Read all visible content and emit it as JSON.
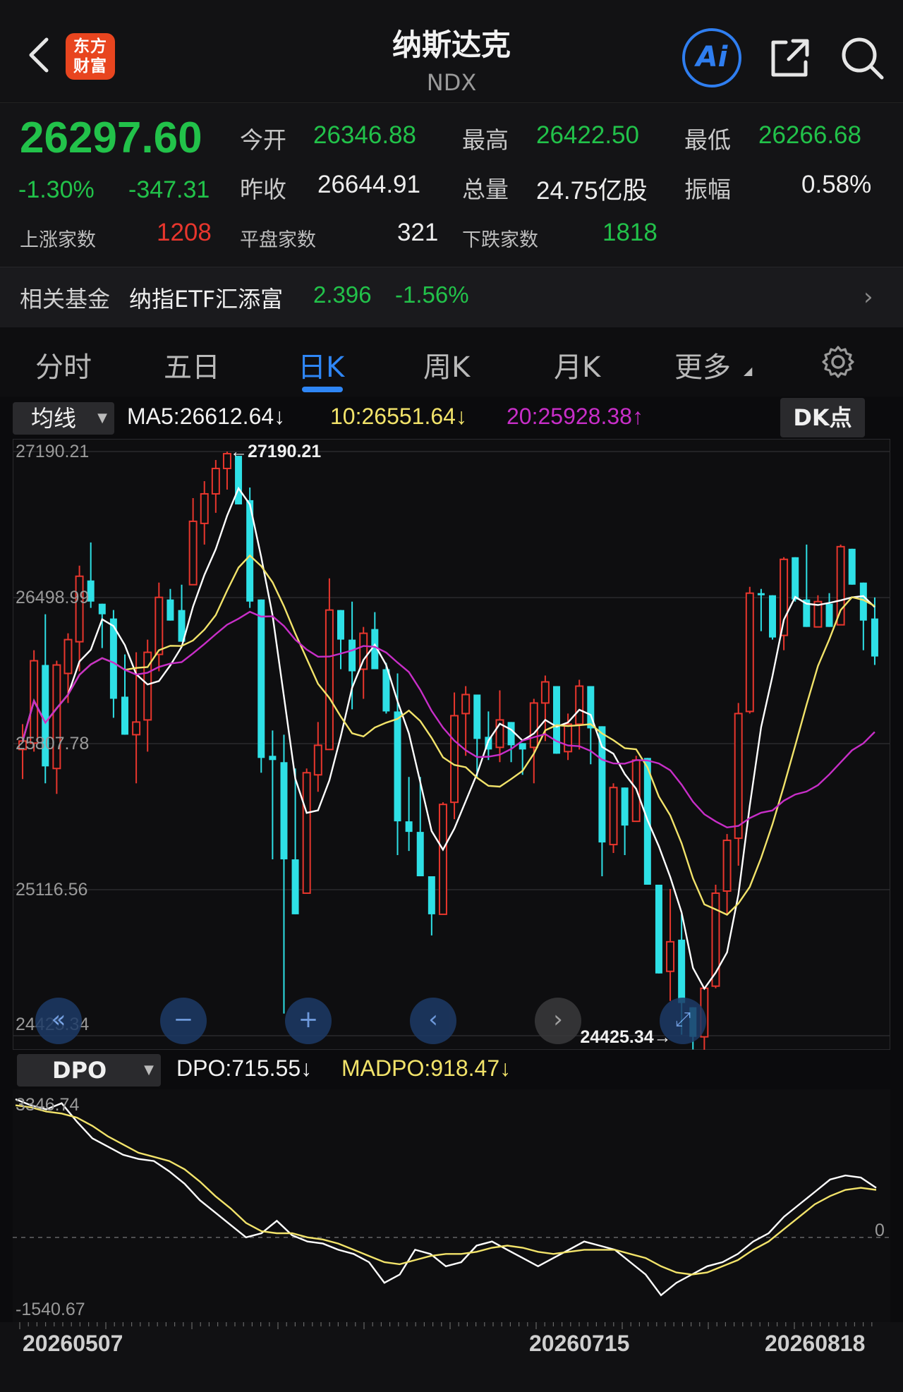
{
  "header": {
    "title": "纳斯达克",
    "code": "NDX",
    "logo_text_line1": "东方",
    "logo_text_line2": "财富",
    "ai_label": "Ai"
  },
  "quote": {
    "price": "26297.60",
    "change_pct": "-1.30%",
    "change": "-347.31",
    "open_label": "今开",
    "open": "26346.88",
    "high_label": "最高",
    "high": "26422.50",
    "low_label": "最低",
    "low": "26266.68",
    "prev_close_label": "昨收",
    "prev_close": "26644.91",
    "volume_label": "总量",
    "volume": "24.75亿股",
    "amplitude_label": "振幅",
    "amplitude": "0.58%",
    "up_count_label": "上涨家数",
    "up_count": "1208",
    "flat_count_label": "平盘家数",
    "flat_count": "321",
    "down_count_label": "下跌家数",
    "down_count": "1818"
  },
  "fund": {
    "label": "相关基金",
    "name": "纳指ETF汇添富",
    "price": "2.396",
    "pct": "-1.56%"
  },
  "tabs": [
    "分时",
    "五日",
    "日K",
    "周K",
    "月K",
    "更多"
  ],
  "active_tab": "日K",
  "ma_legend": {
    "select": "均线",
    "ma5": "MA5:26612.64↓",
    "ma10": "10:26551.64↓",
    "ma20": "20:25928.38↑",
    "dk_label": "DK点"
  },
  "dpo_legend": {
    "select": "DPO",
    "dpo": "DPO:715.55↓",
    "madpo": "MADPO:918.47↓"
  },
  "colors": {
    "up": "#e8362d",
    "down": "#2ee0e6",
    "ma5": "#ffffff",
    "ma10": "#f2e36a",
    "ma20": "#c82ec8",
    "accent": "#2f86f5"
  },
  "chart_data": [
    {
      "type": "candlestick",
      "title": "",
      "y_ticks": [
        "27190.21",
        "26498.99",
        "25807.78",
        "25116.56",
        "24425.34"
      ],
      "ylim": [
        24425.34,
        27190.21
      ],
      "max_marker": "27190.21",
      "min_marker": "24425.34",
      "x_tick_labels": [
        "20260507",
        "20260715",
        "20260818"
      ],
      "candles_ohlc": [
        [
          25780,
          25900,
          25640,
          25820
        ],
        [
          25810,
          26250,
          25770,
          26200
        ],
        [
          26180,
          26420,
          25620,
          25700
        ],
        [
          25690,
          26200,
          25570,
          26180
        ],
        [
          26140,
          26330,
          26000,
          26300
        ],
        [
          26290,
          26650,
          26150,
          26600
        ],
        [
          26580,
          26760,
          26450,
          26480
        ],
        [
          26470,
          26430,
          26260,
          26420
        ],
        [
          26400,
          26440,
          25930,
          26020
        ],
        [
          26030,
          26230,
          25880,
          25850
        ],
        [
          25850,
          26240,
          25620,
          25910
        ],
        [
          25920,
          26300,
          25770,
          26240
        ],
        [
          26230,
          26570,
          26150,
          26500
        ],
        [
          26490,
          26540,
          26440,
          26390
        ],
        [
          26440,
          26560,
          26500,
          26290
        ],
        [
          26560,
          26970,
          26560,
          26860
        ],
        [
          26850,
          27050,
          26750,
          26990
        ],
        [
          26990,
          27150,
          26900,
          27110
        ],
        [
          27110,
          27190,
          27010,
          27180
        ],
        [
          27170,
          27080,
          26960,
          26940
        ],
        [
          26960,
          27020,
          26450,
          26480
        ],
        [
          26490,
          26480,
          25670,
          25740
        ],
        [
          25750,
          25870,
          25260,
          25730
        ],
        [
          25720,
          25850,
          24530,
          25260
        ],
        [
          25260,
          25690,
          25100,
          25000
        ],
        [
          25100,
          25690,
          25350,
          25670
        ],
        [
          25660,
          25910,
          25580,
          25800
        ],
        [
          25780,
          26590,
          25780,
          26440
        ],
        [
          26440,
          26320,
          26160,
          26300
        ],
        [
          26300,
          26480,
          25970,
          26150
        ],
        [
          26160,
          26360,
          26020,
          26330
        ],
        [
          26350,
          26430,
          26180,
          26160
        ],
        [
          26160,
          26190,
          25950,
          25960
        ],
        [
          25960,
          26140,
          25280,
          25440
        ],
        [
          25440,
          25650,
          25300,
          25390
        ],
        [
          25390,
          25650,
          25230,
          25180
        ],
        [
          25180,
          25140,
          24900,
          25000
        ],
        [
          25000,
          25530,
          25090,
          25520
        ],
        [
          25530,
          26050,
          25450,
          25940
        ],
        [
          25950,
          26080,
          25750,
          26040
        ],
        [
          26040,
          25990,
          25650,
          25830
        ],
        [
          25840,
          25960,
          25730,
          25780
        ],
        [
          25790,
          26060,
          25720,
          25920
        ],
        [
          25910,
          25850,
          25720,
          25800
        ],
        [
          25810,
          25770,
          25660,
          25780
        ],
        [
          25790,
          26020,
          25620,
          26000
        ],
        [
          26000,
          26130,
          25820,
          26100
        ],
        [
          26080,
          26010,
          25780,
          25760
        ],
        [
          25770,
          25950,
          25730,
          25900
        ],
        [
          25900,
          26110,
          25780,
          26080
        ],
        [
          26080,
          26040,
          25710,
          25880
        ],
        [
          25890,
          25660,
          25180,
          25340
        ],
        [
          25330,
          25620,
          25290,
          25600
        ],
        [
          25600,
          25410,
          25280,
          25420
        ],
        [
          25440,
          25750,
          25440,
          25730
        ],
        [
          25740,
          25710,
          25180,
          25140
        ],
        [
          25140,
          25020,
          24870,
          24720
        ],
        [
          24730,
          25120,
          24590,
          24870
        ],
        [
          24880,
          25000,
          24430,
          24580
        ],
        [
          24560,
          24430,
          24360,
          24420
        ],
        [
          24420,
          24640,
          24270,
          24650
        ],
        [
          24660,
          25140,
          24650,
          25100
        ],
        [
          25110,
          25380,
          25000,
          25350
        ],
        [
          25360,
          26000,
          25230,
          25950
        ],
        [
          25960,
          26550,
          25950,
          26520
        ],
        [
          26520,
          26540,
          26340,
          26510
        ],
        [
          26510,
          26390,
          26300,
          26310
        ],
        [
          26320,
          26690,
          26250,
          26680
        ],
        [
          26690,
          26610,
          26480,
          26490
        ],
        [
          26490,
          26750,
          26550,
          26360
        ],
        [
          26360,
          26510,
          26400,
          26480
        ],
        [
          26470,
          26520,
          26550,
          26360
        ],
        [
          26370,
          26750,
          26580,
          26740
        ],
        [
          26730,
          26680,
          26620,
          26560
        ],
        [
          26570,
          26320,
          26250,
          26390
        ],
        [
          26400,
          26500,
          26180,
          26220
        ]
      ]
    },
    {
      "type": "line",
      "title": "DPO",
      "y_ticks": [
        "3346.74",
        "0",
        "-1540.67"
      ],
      "ylim": [
        -1540.67,
        3346.74
      ],
      "series": [
        {
          "name": "DPO",
          "values": [
            3346,
            3200,
            3100,
            3250,
            2800,
            2400,
            2200,
            2000,
            1900,
            1850,
            1600,
            1300,
            900,
            600,
            300,
            0,
            100,
            400,
            50,
            -100,
            -150,
            -300,
            -400,
            -600,
            -1100,
            -900,
            -300,
            -400,
            -700,
            -600,
            -200,
            -100,
            -300,
            -500,
            -700,
            -500,
            -300,
            -100,
            -200,
            -300,
            -600,
            -900,
            -1400,
            -1100,
            -900,
            -700,
            -600,
            -400,
            -100,
            100,
            500,
            800,
            1100,
            1400,
            1500,
            1450,
            1200
          ]
        },
        {
          "name": "MADPO",
          "values": [
            3200,
            3150,
            3050,
            3000,
            2900,
            2700,
            2450,
            2250,
            2050,
            1950,
            1850,
            1650,
            1350,
            1000,
            700,
            350,
            150,
            100,
            100,
            0,
            -50,
            -150,
            -300,
            -450,
            -600,
            -650,
            -550,
            -450,
            -400,
            -400,
            -350,
            -250,
            -200,
            -250,
            -350,
            -400,
            -350,
            -300,
            -300,
            -300,
            -400,
            -500,
            -700,
            -850,
            -900,
            -850,
            -700,
            -550,
            -300,
            -100,
            200,
            500,
            800,
            1000,
            1150,
            1200,
            1150
          ]
        }
      ]
    }
  ]
}
